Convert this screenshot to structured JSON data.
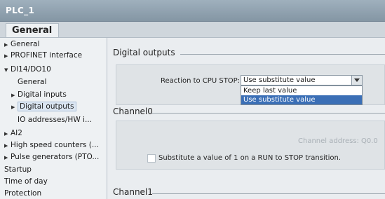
{
  "window": {
    "title": "PLC_1"
  },
  "tabs": [
    {
      "label": "General"
    }
  ],
  "tree": {
    "items": [
      {
        "label": "General",
        "arrow": "▶"
      },
      {
        "label": "PROFINET interface",
        "arrow": "▶"
      },
      {
        "label": "DI14/DO10",
        "arrow": "▼"
      },
      {
        "label": "General",
        "arrow": ""
      },
      {
        "label": "Digital inputs",
        "arrow": "▶"
      },
      {
        "label": "Digital outputs",
        "arrow": "▶"
      },
      {
        "label": "IO addresses/HW i...",
        "arrow": ""
      },
      {
        "label": "AI2",
        "arrow": "▶"
      },
      {
        "label": "High speed counters (...",
        "arrow": "▶"
      },
      {
        "label": "Pulse generators (PTO...",
        "arrow": "▶"
      },
      {
        "label": "Startup",
        "arrow": ""
      },
      {
        "label": "Time of day",
        "arrow": ""
      },
      {
        "label": "Protection",
        "arrow": ""
      }
    ]
  },
  "digital_outputs": {
    "title": "Digital outputs",
    "reaction_label": "Reaction to CPU STOP:",
    "reaction_value": "Use substitute value",
    "options": [
      "Keep last value",
      "Use substitute value"
    ]
  },
  "channel0": {
    "title": "Channel0",
    "address_label": "Channel address:",
    "address_value": "Q0.0",
    "substitute_label": "Substitute a value of 1 on a RUN to STOP transition."
  },
  "channel1": {
    "title": "Channel1"
  },
  "icons": {
    "tree_expand": "chevron-right-icon",
    "tree_collapse": "chevron-down-icon",
    "dropdown": "chevron-down-icon"
  },
  "colors": {
    "selected_option": "#3b6fb6",
    "title_bar": "#8ea0ae"
  }
}
